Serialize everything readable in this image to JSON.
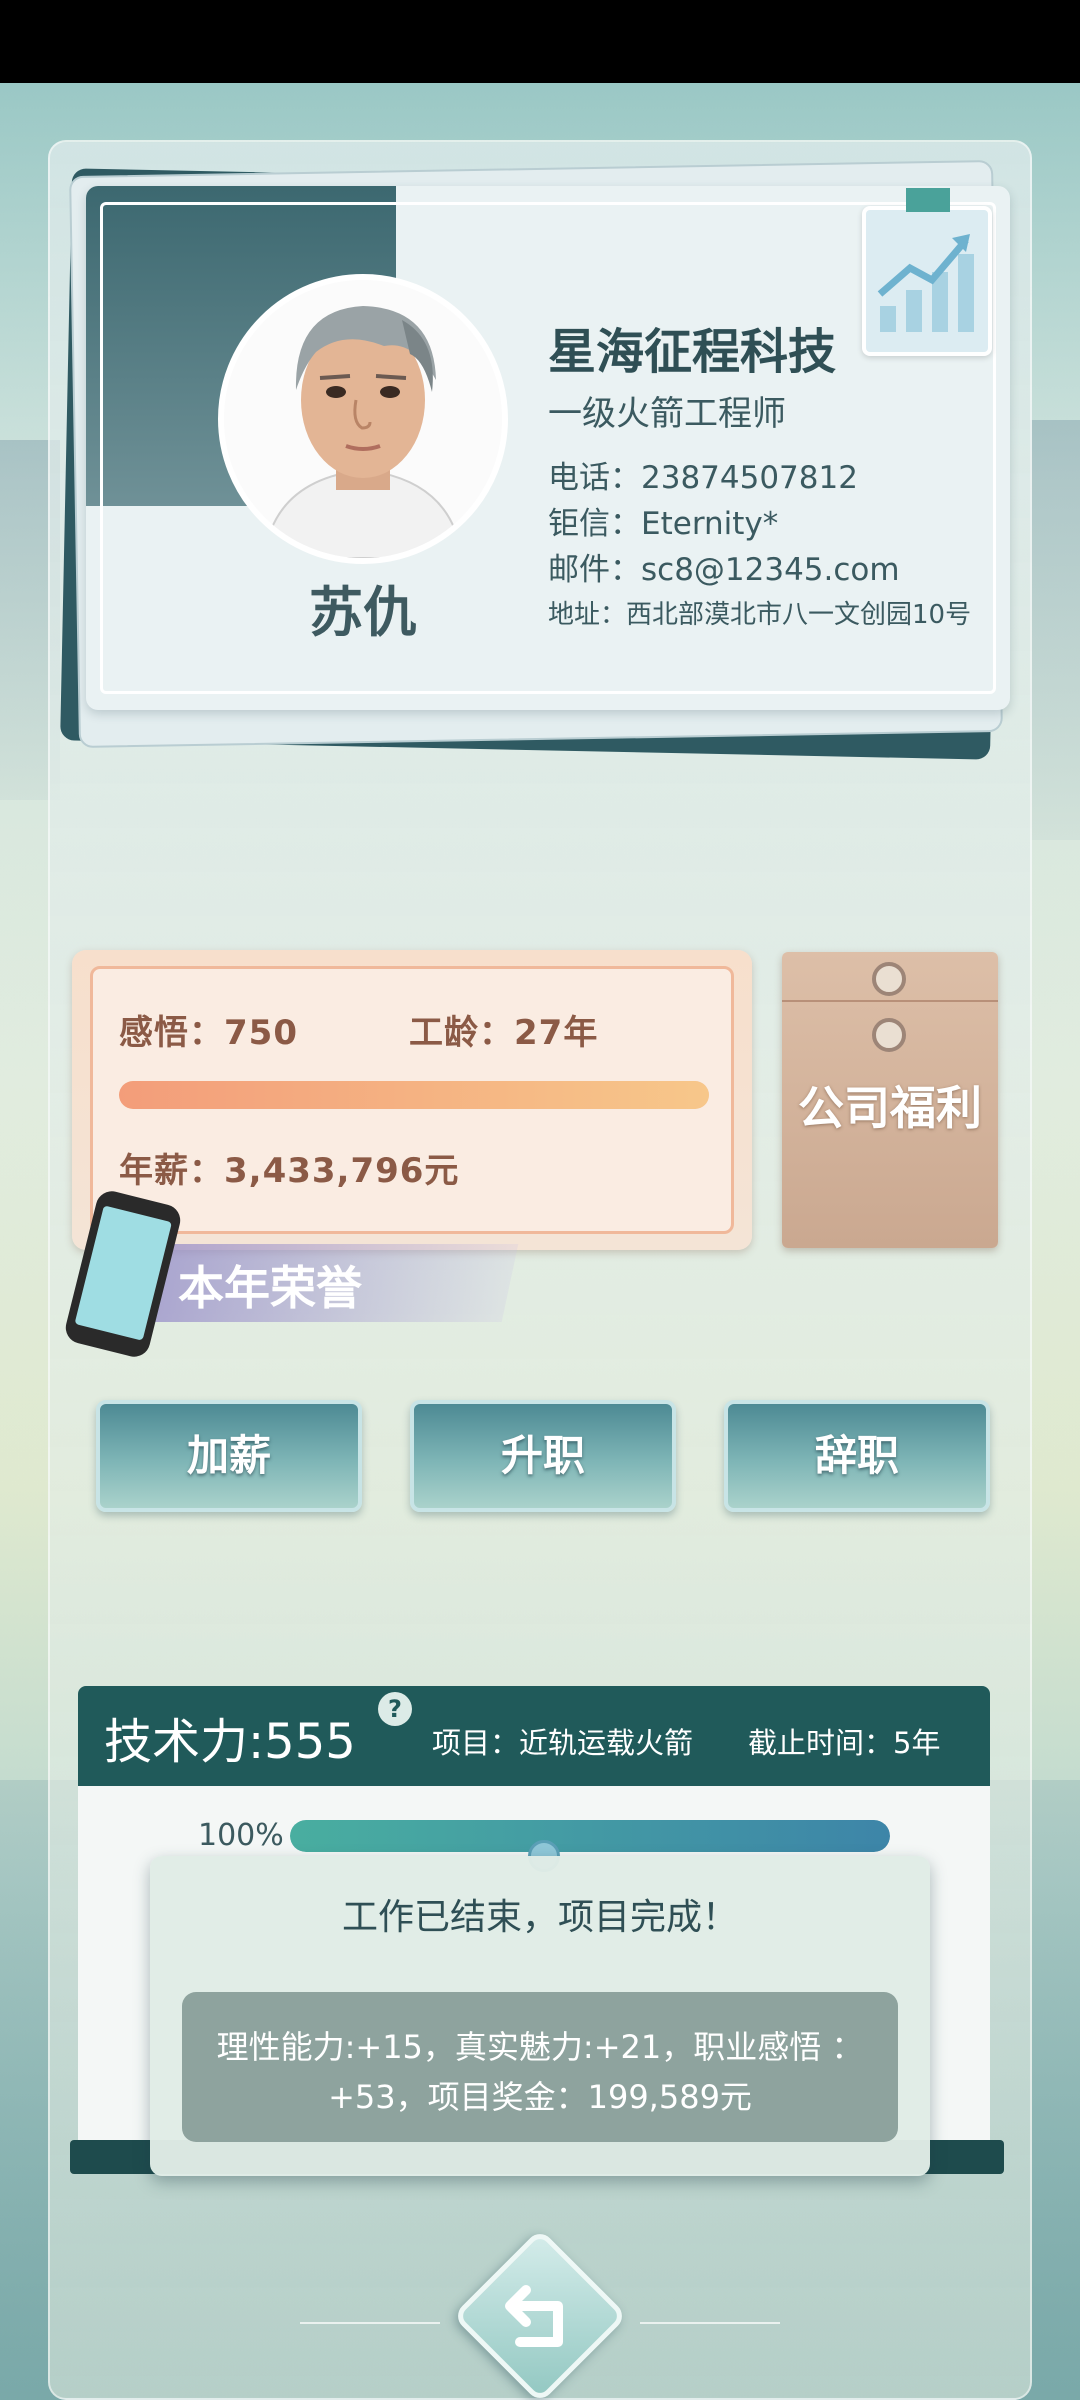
{
  "profile": {
    "name": "苏仇",
    "company": "星海征程科技",
    "position": "一级火箭工程师",
    "phone": "电话：23874507812",
    "chat": "钜信：Eternity*",
    "email": "邮件：sc8@12345.com",
    "address": "地址：西北部漠北市八一文创园10号"
  },
  "stats": {
    "insight": "感悟：750",
    "seniority": "工龄：27年",
    "salary": "年薪：3,433,796元",
    "bar_fraction": 1.0
  },
  "benefits_label": "公司福利",
  "honor_label": "本年荣誉",
  "actions": {
    "raise": "加薪",
    "promote": "升职",
    "resign": "辞职"
  },
  "project": {
    "tech_power": "技术力:555",
    "help": "?",
    "name": "项目：近轨运载火箭",
    "deadline": "截止时间：5年",
    "progress_label": "100%",
    "progress_fraction": 1.0
  },
  "result": {
    "title": "工作已结束，项目完成！",
    "line1": "理性能力:+15，真实魅力:+21，职业感悟 ：",
    "line2": "+53，项目奖金：199,589元"
  },
  "colors": {
    "header_teal": "#205a5a",
    "salary_text": "#8b5a46",
    "progress": "#49aea0"
  }
}
